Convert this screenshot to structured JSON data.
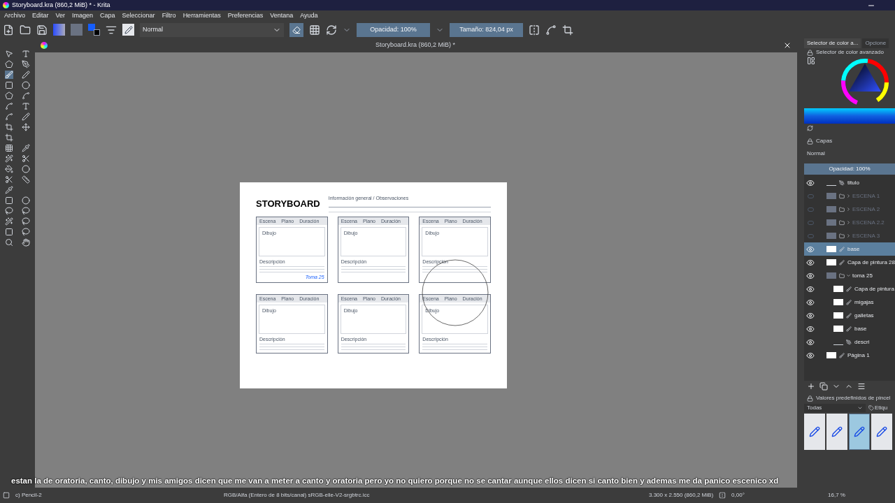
{
  "window": {
    "title": "Storyboard.kra (860,2 MiB) * - Krita"
  },
  "menu": [
    "Archivo",
    "Editar",
    "Ver",
    "Imagen",
    "Capa",
    "Seleccionar",
    "Filtro",
    "Herramientas",
    "Preferencias",
    "Ventana",
    "Ayuda"
  ],
  "toolbar": {
    "blend_mode": "Normal",
    "eraser_on": true,
    "opacity": "Opacidad: 100%",
    "opacity_level": {
      "level": 1
    },
    "size": "Tamaño: 824,04 px",
    "size_level": {
      "level": 1
    }
  },
  "document_tab": {
    "title": "Storyboard.kra (860,2 MiB) *"
  },
  "storyboard": {
    "title": "STORYBOARD",
    "info_label": "Información general / Observaciones",
    "panels": [
      {
        "scene": "Escena",
        "shot": "Plano",
        "duration": "Duración",
        "drawing": "Dibujo",
        "description": "Descripción",
        "note": "Toma 25"
      },
      {
        "scene": "Escena",
        "shot": "Plano",
        "duration": "Duración",
        "drawing": "Dibujo",
        "description": "Descripción"
      },
      {
        "scene": "Escena",
        "shot": "Plano",
        "duration": "Duración",
        "drawing": "Dibujo",
        "description": "Descripción"
      },
      {
        "scene": "Escena",
        "shot": "Plano",
        "duration": "Duración",
        "drawing": "Dibujo",
        "description": "Descripción"
      },
      {
        "scene": "Escena",
        "shot": "Plano",
        "duration": "Duración",
        "drawing": "Dibujo",
        "description": "Descripción"
      },
      {
        "scene": "Escena",
        "shot": "Plano",
        "duration": "Duración",
        "drawing": "Dibujo",
        "description": "Descripción"
      }
    ]
  },
  "color_docker": {
    "tabs": [
      {
        "label": "Selector de color a...",
        "selected": true
      },
      {
        "label": "Opcione",
        "selected": false
      }
    ],
    "title": "Selector de color avanzado"
  },
  "layers_docker": {
    "title": "Capas",
    "blend_mode": "Normal",
    "opacity": "Opacidad:  100%",
    "opacity_level": {
      "level": 1
    },
    "layers": [
      {
        "name": "titulo",
        "kind": "vector",
        "visible": true,
        "selected": false
      },
      {
        "name": "ESCENA 1",
        "kind": "group",
        "visible": false,
        "selected": false,
        "expanded": false
      },
      {
        "name": "ESCENA 2",
        "kind": "group",
        "visible": false,
        "selected": false,
        "expanded": false
      },
      {
        "name": "ESCENA 2.2",
        "kind": "group",
        "visible": false,
        "selected": false,
        "expanded": false
      },
      {
        "name": "ESCENA 3",
        "kind": "group",
        "visible": false,
        "selected": false,
        "expanded": false
      },
      {
        "name": "base",
        "kind": "paint",
        "visible": true,
        "selected": true
      },
      {
        "name": "Capa de pintura 28",
        "kind": "paint",
        "visible": true,
        "selected": false
      },
      {
        "name": "toma 25",
        "kind": "group",
        "visible": true,
        "selected": false,
        "expanded": true,
        "children": [
          {
            "name": "Capa de pintura",
            "kind": "paint",
            "visible": true,
            "selected": false
          },
          {
            "name": "migajas",
            "kind": "paint",
            "visible": true,
            "selected": false
          },
          {
            "name": "galletas",
            "kind": "paint",
            "visible": true,
            "selected": false
          },
          {
            "name": "base",
            "kind": "paint",
            "visible": true,
            "selected": false
          },
          {
            "name": "descri",
            "kind": "vector",
            "visible": true,
            "selected": false
          }
        ]
      },
      {
        "name": "Página 1",
        "kind": "paint",
        "visible": true,
        "selected": false
      }
    ]
  },
  "brush_docker": {
    "title": "Valores predefinidos de pincel",
    "filter": "Todas",
    "tag": "Etiqu",
    "presets": [
      {
        "selected": false
      },
      {
        "selected": false
      },
      {
        "selected": true
      },
      {
        "selected": false
      }
    ]
  },
  "subtitle": "estan la de oratoria, canto, dibujo y mis amigos dicen que me van a meter a canto y oratoria pero yo no quiero porque no se cantar aunque ellos dicen si canto bien y ademas me da panico escenico xd",
  "status_bar": {
    "tool": "c) Pencil-2",
    "color_space": "RGB/Alfa (Entero de 8 bits/canal)  sRGB-elle-V2-srgbtrc.icc",
    "dimensions": "3.300 x 2.550 (860,2 MiB)",
    "rotation": "0,00°",
    "zoom": "16,7 %"
  }
}
